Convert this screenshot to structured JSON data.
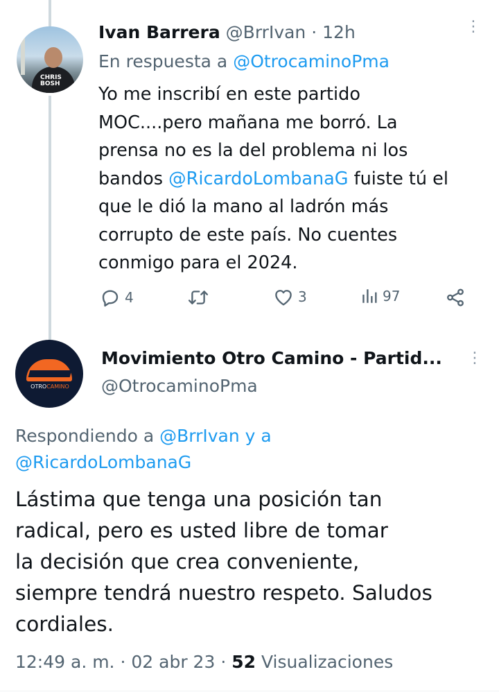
{
  "reply_tweet": {
    "display_name": "Ivan Barrera",
    "handle": "@BrrIvan",
    "separator": "·",
    "age": "12h",
    "in_reply_prefix": "En respuesta a",
    "in_reply_handle": "@OtrocaminoPma",
    "avatar_print": "CHRIS\nBOSH",
    "body_part1": "Yo me inscribí en este partido\nMOC....pero mañana me borró.  La\nprensa no es la del problema ni los\nbandos ",
    "body_mention": "@RicardoLombanaG",
    "body_part2": " fuiste tú el\nque le dió la mano al ladrón más\ncorrupto de este país.  No cuentes\nconmigo para el 2024.",
    "replies_count": "4",
    "likes_count": "3",
    "views_count": "97",
    "icons": [
      "reply-icon",
      "retweet-icon",
      "like-icon",
      "views-icon",
      "share-icon",
      "more-icon"
    ]
  },
  "main_tweet": {
    "display_name": "Movimiento Otro Camino - Partid...",
    "handle": "@OtrocaminoPma",
    "avatar_brand_1": "OTRO",
    "avatar_brand_2": "CAMINO",
    "replying_prefix": "Respondiendo a",
    "replying_handle_1": "@BrrIvan",
    "replying_joiner": "y a",
    "replying_handle_2": "@RicardoLombanaG",
    "body": "Lástima que tenga una posición tan\nradical, pero es usted libre de tomar\nla decisión que crea conveniente,\nsiempre tendrá nuestro respeto. Saludos\ncordiales.",
    "time": "12:49 a. m.",
    "date": "02 abr 23",
    "views_count": "52",
    "views_label": "Visualizaciones"
  },
  "colors": {
    "link": "#1d9bf0",
    "muted": "#536471",
    "text": "#0f1419",
    "thread_line": "#cfd9de",
    "brand_orange": "#f26722"
  }
}
